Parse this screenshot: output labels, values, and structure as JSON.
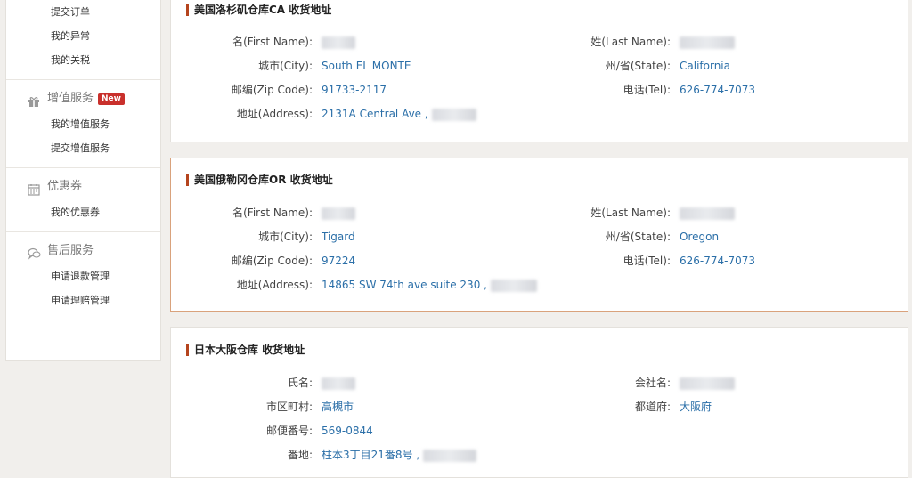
{
  "sidebar": {
    "top_items": [
      "提交订单",
      "我的异常",
      "我的关税"
    ],
    "value_added": {
      "title": "增值服务",
      "badge": "New",
      "items": [
        "我的增值服务",
        "提交增值服务"
      ]
    },
    "coupons": {
      "title": "优惠券",
      "items": [
        "我的优惠券"
      ]
    },
    "after_sales": {
      "title": "售后服务",
      "items": [
        "申请退款管理",
        "申请理赔管理"
      ]
    }
  },
  "ca": {
    "title": "美国洛杉矶仓库CA 收货地址",
    "first_name_label": "名(First Name):",
    "last_name_label": "姓(Last Name):",
    "city_label": "城市(City):",
    "city": "South EL MONTE",
    "state_label": "州/省(State):",
    "state": "California",
    "zip_label": "邮编(Zip Code):",
    "zip": "91733-2117",
    "tel_label": "电话(Tel):",
    "tel": "626-774-7073",
    "address_label": "地址(Address):",
    "address": "2131A Central Ave ,"
  },
  "or": {
    "title": "美国俄勒冈仓库OR 收货地址",
    "first_name_label": "名(First Name):",
    "last_name_label": "姓(Last Name):",
    "city_label": "城市(City):",
    "city": "Tigard",
    "state_label": "州/省(State):",
    "state": "Oregon",
    "zip_label": "邮编(Zip Code):",
    "zip": "97224",
    "tel_label": "电话(Tel):",
    "tel": "626-774-7073",
    "address_label": "地址(Address):",
    "address": "14865 SW 74th ave suite 230 ,"
  },
  "jp": {
    "title": "日本大阪仓库 收货地址",
    "name_label": "氏名:",
    "company_label": "会社名:",
    "city_label": "市区町村:",
    "city": "高槻市",
    "prefecture_label": "都道府:",
    "prefecture": "大阪府",
    "postal_label": "邮便番号:",
    "postal": "569-0844",
    "address_label": "番地:",
    "address": "柱本3丁目21番8号 ,"
  }
}
